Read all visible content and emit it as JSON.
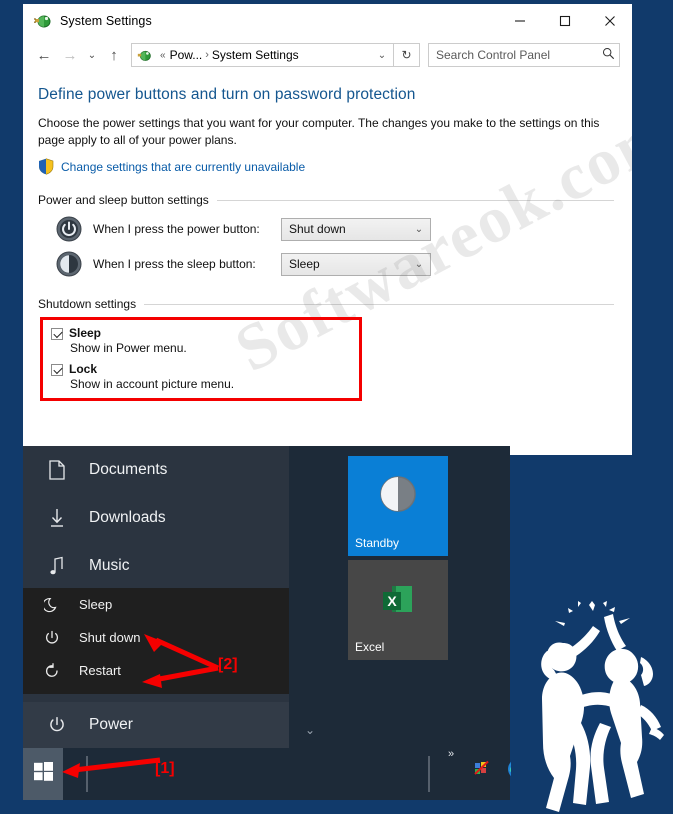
{
  "window": {
    "title": "System Settings",
    "title_icon": "power-settings-icon",
    "minimize": "–",
    "maximize": "□",
    "close": "✕"
  },
  "addressbar": {
    "back": "←",
    "forward": "→",
    "recent": "⌄",
    "up": "↑",
    "crumb_icon": "power-options-icon",
    "crumb_overflow": "«",
    "crumb_parent": "Pow...",
    "crumb_sep": "›",
    "crumb_current": "System Settings",
    "dropdown": "⌄",
    "refresh": "↻",
    "search_placeholder": "Search Control Panel",
    "search_value": "",
    "search_icon": "search-icon"
  },
  "content": {
    "heading": "Define power buttons and turn on password protection",
    "description": "Choose the power settings that you want for your computer. The changes you make to the settings on this page apply to all of your power plans.",
    "shield_link": "Change settings that are currently unavailable"
  },
  "power_group": {
    "title": "Power and sleep button settings",
    "rows": [
      {
        "icon": "power-button-icon",
        "label": "When I press the power button:",
        "value": "Shut down"
      },
      {
        "icon": "sleep-button-icon",
        "label": "When I press the sleep button:",
        "value": "Sleep"
      }
    ]
  },
  "shutdown_group": {
    "title": "Shutdown settings",
    "items": [
      {
        "label": "Sleep",
        "sub": "Show in Power menu.",
        "checked": true
      },
      {
        "label": "Lock",
        "sub": "Show in account picture menu.",
        "checked": true
      }
    ],
    "highlight_color": "#f40000"
  },
  "watermark": {
    "text": "Softwareok.com",
    "start_text": "Softwar"
  },
  "start_menu": {
    "items": [
      {
        "icon": "document-icon",
        "label": "Documents"
      },
      {
        "icon": "download-icon",
        "label": "Downloads"
      },
      {
        "icon": "music-icon",
        "label": "Music"
      }
    ],
    "power_entry": {
      "icon": "power-icon",
      "label": "Power"
    },
    "power_flyout": [
      {
        "icon": "moon-icon",
        "label": "Sleep"
      },
      {
        "icon": "power-icon",
        "label": "Shut down"
      },
      {
        "icon": "restart-icon",
        "label": "Restart"
      }
    ],
    "scroll_chevron": "⌄",
    "tiles": [
      {
        "label": "Standby",
        "color": "#0a7fd6",
        "icon": "standby-orb-icon"
      },
      {
        "label": "Excel",
        "color": "#474747",
        "icon": "excel-icon"
      }
    ]
  },
  "taskbar": {
    "start_button": "windows-logo-icon",
    "tray_chevron": "»",
    "tray_icons": [
      {
        "name": "network-blocked-icon"
      },
      {
        "name": "edge-browser-icon"
      }
    ]
  },
  "annotations": [
    {
      "id": "1",
      "label": "[1]"
    },
    {
      "id": "2",
      "label": "[2]"
    }
  ],
  "colors": {
    "page_bg": "#113a6b",
    "heading": "#14568f",
    "link": "#0a5ca8",
    "annotation": "#f60000",
    "tile_blue": "#0a7fd6",
    "taskbar": "#1d2a38"
  }
}
